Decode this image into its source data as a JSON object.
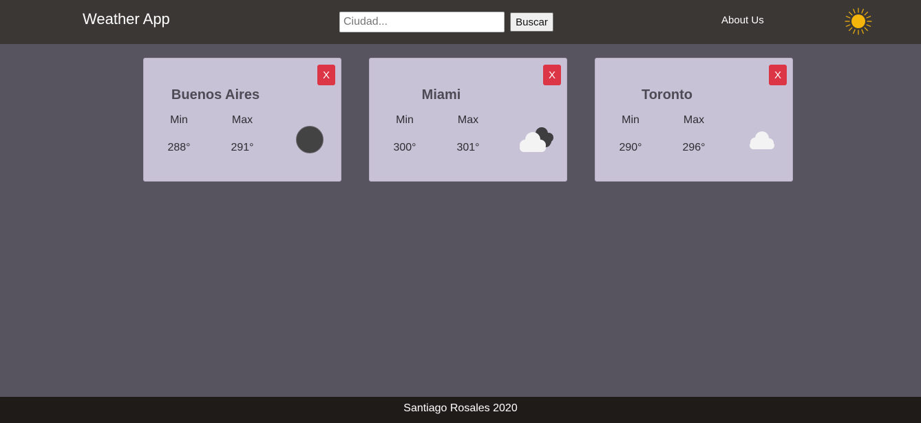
{
  "header": {
    "title": "Weather App",
    "search_placeholder": "Ciudad...",
    "search_value": "",
    "search_button": "Buscar",
    "about_link": "About Us",
    "logo_icon": "sun-icon"
  },
  "cards": [
    {
      "city": "Buenos Aires",
      "min_label": "Min",
      "max_label": "Max",
      "min": "288°",
      "max": "291°",
      "close_label": "X",
      "icon": "dark-circle-icon"
    },
    {
      "city": "Miami",
      "min_label": "Min",
      "max_label": "Max",
      "min": "300°",
      "max": "301°",
      "close_label": "X",
      "icon": "dark-clouds-icon"
    },
    {
      "city": "Toronto",
      "min_label": "Min",
      "max_label": "Max",
      "min": "290°",
      "max": "296°",
      "close_label": "X",
      "icon": "cloud-icon"
    }
  ],
  "footer": {
    "text": "Santiago Rosales 2020"
  },
  "colors": {
    "header_bg": "#3b3735",
    "body_bg": "#57535f",
    "card_bg": "#c7c2d5",
    "close_button": "#dc3545",
    "footer_bg": "#1f1b19",
    "sun": "#f5b50b"
  }
}
